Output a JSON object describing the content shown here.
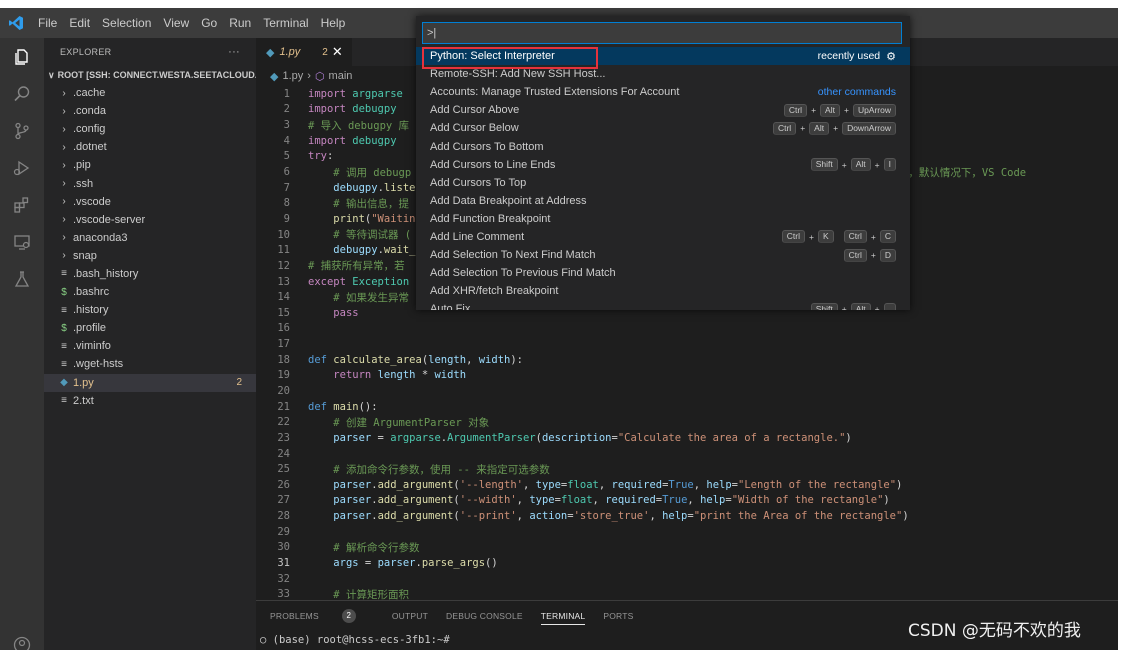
{
  "window": {
    "menu": [
      "File",
      "Edit",
      "Selection",
      "View",
      "Go",
      "Run",
      "Terminal",
      "Help"
    ]
  },
  "explorer": {
    "title": "EXPLORER",
    "more": "···",
    "root": "ROOT [SSH: CONNECT.WESTA.SEETACLOUD...",
    "items": [
      {
        "icon": "chevron-right",
        "label": ".cache"
      },
      {
        "icon": "chevron-right",
        "label": ".conda"
      },
      {
        "icon": "chevron-right",
        "label": ".config"
      },
      {
        "icon": "chevron-right",
        "label": ".dotnet"
      },
      {
        "icon": "chevron-right",
        "label": ".pip"
      },
      {
        "icon": "chevron-right",
        "label": ".ssh"
      },
      {
        "icon": "chevron-right",
        "label": ".vscode"
      },
      {
        "icon": "chevron-right",
        "label": ".vscode-server"
      },
      {
        "icon": "chevron-right",
        "label": "anaconda3"
      },
      {
        "icon": "chevron-right",
        "label": "snap"
      },
      {
        "icon": "lines",
        "label": ".bash_history"
      },
      {
        "icon": "dollar",
        "label": ".bashrc"
      },
      {
        "icon": "lines",
        "label": ".history"
      },
      {
        "icon": "dollar",
        "label": ".profile"
      },
      {
        "icon": "lines",
        "label": ".viminfo"
      },
      {
        "icon": "lines",
        "label": ".wget-hsts"
      },
      {
        "icon": "python",
        "label": "1.py",
        "badge": "2",
        "selected": true
      },
      {
        "icon": "lines",
        "label": "2.txt"
      }
    ]
  },
  "editor": {
    "tab_label": "1.py",
    "tab_count": "2",
    "breadcrumb_file": "1.py",
    "breadcrumb_symbol": "main",
    "active_line": 31
  },
  "palette": {
    "input_value": ">|",
    "items": [
      {
        "label": "Python: Select Interpreter",
        "focused": true,
        "recent": "recently used"
      },
      {
        "label": "Remote-SSH: Add New SSH Host..."
      },
      {
        "label": "Accounts: Manage Trusted Extensions For Account",
        "hint": "other commands"
      },
      {
        "label": "Add Cursor Above",
        "keys": [
          [
            "Ctrl",
            "Alt",
            "UpArrow"
          ]
        ]
      },
      {
        "label": "Add Cursor Below",
        "keys": [
          [
            "Ctrl",
            "Alt",
            "DownArrow"
          ]
        ]
      },
      {
        "label": "Add Cursors To Bottom"
      },
      {
        "label": "Add Cursors to Line Ends",
        "keys": [
          [
            "Shift",
            "Alt",
            "I"
          ]
        ]
      },
      {
        "label": "Add Cursors To Top"
      },
      {
        "label": "Add Data Breakpoint at Address"
      },
      {
        "label": "Add Function Breakpoint"
      },
      {
        "label": "Add Line Comment",
        "keys": [
          [
            "Ctrl",
            "K"
          ],
          [
            "Ctrl",
            "C"
          ]
        ]
      },
      {
        "label": "Add Selection To Next Find Match",
        "keys": [
          [
            "Ctrl",
            "D"
          ]
        ]
      },
      {
        "label": "Add Selection To Previous Find Match"
      },
      {
        "label": "Add XHR/fetch Breakpoint"
      },
      {
        "label": "Auto Fix...",
        "keys": [
          [
            "Shift",
            "Alt",
            "."
          ]
        ]
      }
    ]
  },
  "panel": {
    "tabs": [
      "PROBLEMS",
      "OUTPUT",
      "DEBUG CONSOLE",
      "TERMINAL",
      "PORTS"
    ],
    "problems_count": "2",
    "active_tab": "TERMINAL",
    "terminal_line": "○ (base) root@hcss-ecs-3fb1:~#"
  },
  "watermark": "CSDN @无码不欢的我",
  "colors": {
    "accent": "#007fd4",
    "highlight_box": "#e5323c",
    "modified_file": "#e2c08d"
  }
}
